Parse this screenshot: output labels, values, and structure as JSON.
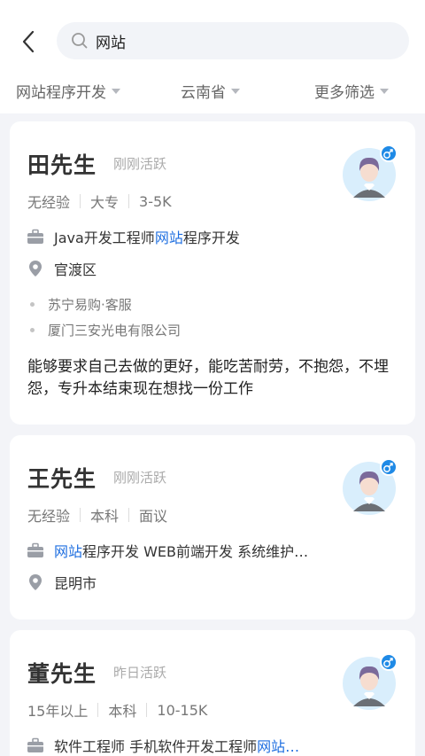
{
  "search": {
    "query": "网站"
  },
  "filters": [
    {
      "label": "网站程序开发"
    },
    {
      "label": "云南省"
    },
    {
      "label": "更多筛选"
    }
  ],
  "candidates": [
    {
      "name": "田先生",
      "activity": "刚刚活跃",
      "experience": "无经验",
      "education": "大专",
      "salary": "3-5K",
      "job_prefix": "Java开发工程师 ",
      "job_highlight": "网站",
      "job_suffix": "程序开发",
      "location": "官渡区",
      "history": [
        "苏宁易购·客服",
        "厦门三安光电有限公司"
      ],
      "description": "能够要求自己去做的更好，能吃苦耐劳，不抱怨，不埋怨，专升本结束现在想找一份工作",
      "gender": "male"
    },
    {
      "name": "王先生",
      "activity": "刚刚活跃",
      "experience": "无经验",
      "education": "本科",
      "salary": "面议",
      "job_prefix": "",
      "job_highlight": "网站",
      "job_suffix": "程序开发 WEB前端开发 系统维护…",
      "location": "昆明市",
      "gender": "male"
    },
    {
      "name": "董先生",
      "activity": "昨日活跃",
      "experience": "15年以上",
      "education": "本科",
      "salary": "10-15K",
      "job_prefix": "软件工程师 手机软件开发工程师 ",
      "job_highlight": "网站…",
      "job_suffix": "",
      "gender": "male"
    }
  ],
  "colors": {
    "highlight": "#1f6fe0",
    "gender_badge": "#1f8ae6",
    "avatar_bg": "#d9eefc"
  },
  "icons": {
    "back": "chevron-left-icon",
    "search": "search-icon",
    "job": "briefcase-icon",
    "location": "location-pin-icon",
    "gender": "male-icon"
  }
}
